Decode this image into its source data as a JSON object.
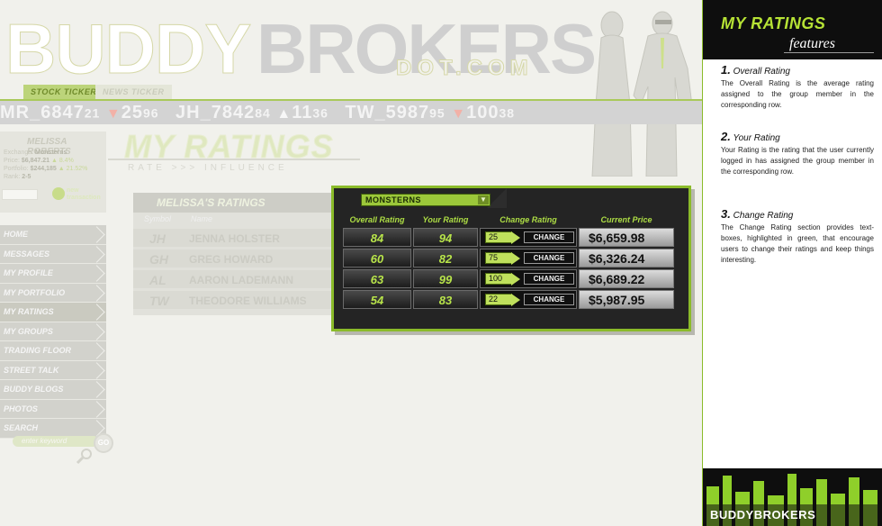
{
  "brand": {
    "part1": "BUDDY",
    "part2": "BROKERS",
    "part3": "DOT.COM"
  },
  "ticker": {
    "tabs": [
      "STOCK TICKER",
      "NEWS TICKER"
    ],
    "items": [
      {
        "sym": "MR_",
        "price": "6847",
        "frac": "21",
        "dir": "down",
        "chg": "25",
        "chgfrac": "96"
      },
      {
        "sym": "JH_",
        "price": "7842",
        "frac": "84",
        "dir": "up",
        "chg": "11",
        "chgfrac": "36"
      },
      {
        "sym": "TW_",
        "price": "5987",
        "frac": "95",
        "dir": "down",
        "chg": "100",
        "chgfrac": "38"
      }
    ]
  },
  "user": {
    "name": "MELISSA ROBERTS",
    "lines": [
      {
        "label": "Exchange:",
        "value": "Monsterns",
        "extra": ""
      },
      {
        "label": "Price:",
        "value": "$6,847.21",
        "extra": "▲ 8.4%"
      },
      {
        "label": "Portfolio:",
        "value": "$244,185",
        "extra": "▲ 21.52%"
      },
      {
        "label": "Rank:",
        "value": "2-5",
        "extra": ""
      }
    ],
    "new_transaction": "new transaction"
  },
  "nav": [
    "HOME",
    "MESSAGES",
    "MY PROFILE",
    "MY PORTFOLIO",
    "MY RATINGS",
    "MY GROUPS",
    "TRADING FLOOR",
    "STREET TALK",
    "BUDDY BLOGS",
    "PHOTOS",
    "SEARCH"
  ],
  "search": {
    "placeholder": "enter keyword",
    "go": "GO"
  },
  "page": {
    "title": "MY RATINGS",
    "subtitle": "RATE >>> INFLUENCE"
  },
  "ratings": {
    "heading_prefix": "MELISSA'S",
    "heading_suffix": "RATINGS",
    "group": "MONSTERNS",
    "headers": {
      "symbol": "Symbol",
      "name": "Name",
      "overall": "Overall Rating",
      "your": "Your Rating",
      "change": "Change Rating",
      "price": "Current Price"
    },
    "change_label": "CHANGE",
    "rows": [
      {
        "symbol": "JH",
        "name": "JENNA HOLSTER",
        "overall": "84",
        "your": "94",
        "input": "25",
        "price": "$6,659.98"
      },
      {
        "symbol": "GH",
        "name": "GREG HOWARD",
        "overall": "60",
        "your": "82",
        "input": "75",
        "price": "$6,326.24"
      },
      {
        "symbol": "AL",
        "name": "AARON LADEMANN",
        "overall": "63",
        "your": "99",
        "input": "100",
        "price": "$6,689.22"
      },
      {
        "symbol": "TW",
        "name": "THEODORE WILLIAMS",
        "overall": "54",
        "your": "83",
        "input": "22",
        "price": "$5,987.95"
      }
    ]
  },
  "features": {
    "title": "MY RATINGS",
    "subtitle": "features",
    "items": [
      {
        "num": "1.",
        "heading": "Overall Rating",
        "text": "The Overall Rating is the average rating assigned to the group member in the corresponding row."
      },
      {
        "num": "2.",
        "heading": "Your Rating",
        "text": "Your Rating is the rating that the user currently logged in has assigned the group member in the corresponding row."
      },
      {
        "num": "3.",
        "heading": "Change Rating",
        "text": "The Change Rating section provides text-boxes, highlighted in green, that encourage users to change their ratings and keep things interesting."
      }
    ],
    "footer_logo_a": "BUDDY",
    "footer_logo_b": "BROKERS"
  },
  "colors": {
    "accent": "#9cc83a",
    "panel_bg": "#242424",
    "rating_text": "#b8e44a"
  }
}
